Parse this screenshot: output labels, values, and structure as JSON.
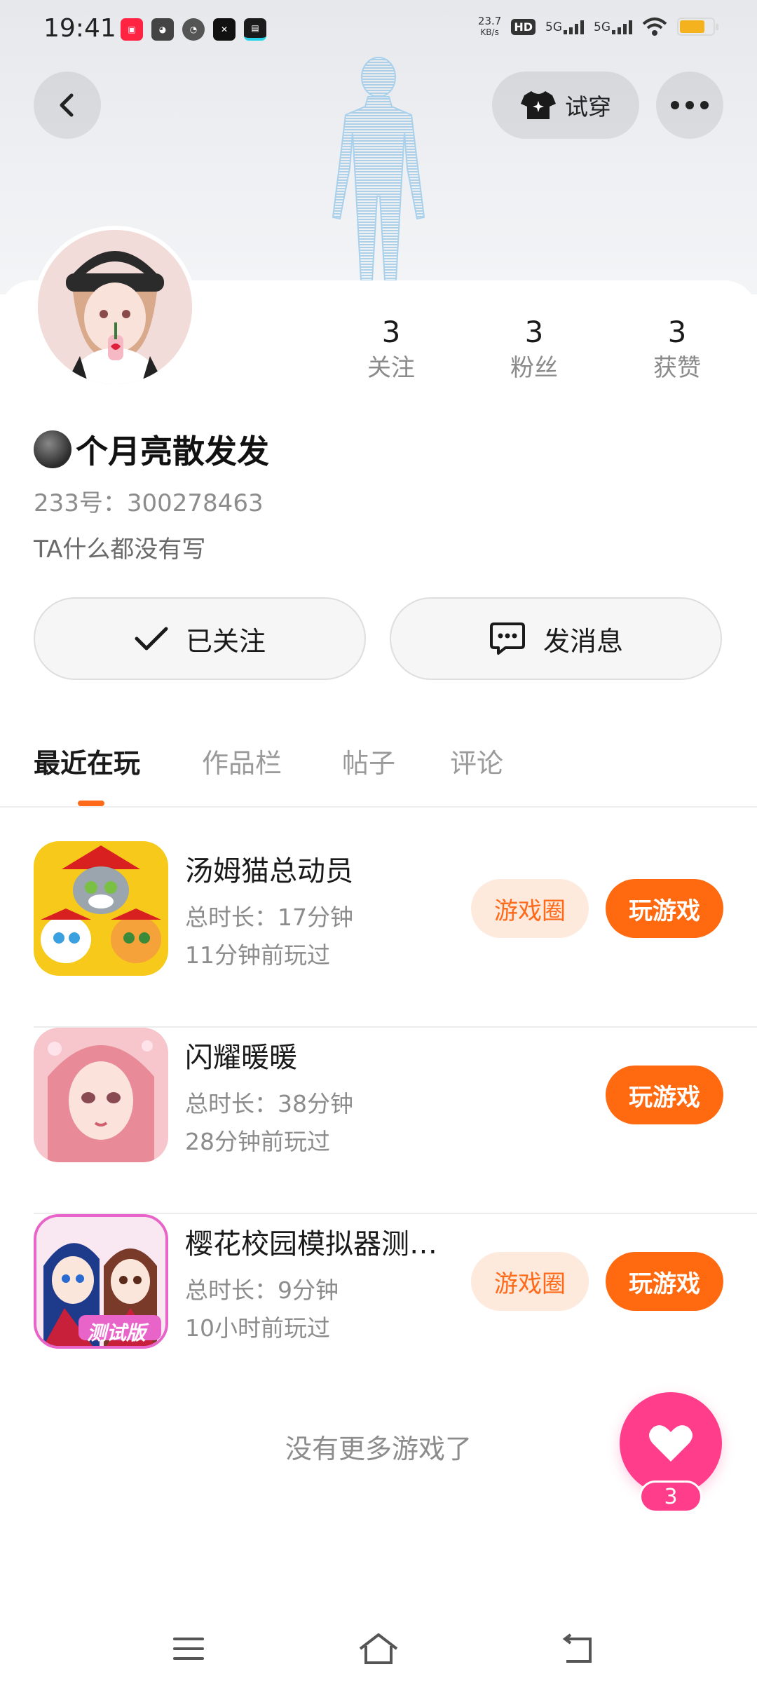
{
  "status_bar": {
    "time": "19:41",
    "net_speed_value": "23.7",
    "net_speed_unit": "KB/s",
    "hd_label": "HD",
    "sim1": "5G",
    "sim2": "5G",
    "app_icons": [
      "xiaohongshu-icon",
      "cat-icon",
      "speedometer-icon",
      "capcut-icon",
      "youku-icon"
    ],
    "battery_level": 0.76
  },
  "header": {
    "try_on_label": "试穿"
  },
  "profile": {
    "nickname": "个月亮散发发",
    "uid": "233号：300278463",
    "bio": "TA什么都没有写",
    "stats": [
      {
        "value": "3",
        "label": "关注"
      },
      {
        "value": "3",
        "label": "粉丝"
      },
      {
        "value": "3",
        "label": "获赞"
      }
    ]
  },
  "actions": {
    "followed_label": "已关注",
    "message_label": "发消息"
  },
  "tabs": [
    {
      "label": "最近在玩",
      "active": true
    },
    {
      "label": "作品栏",
      "active": false
    },
    {
      "label": "帖子",
      "active": false
    },
    {
      "label": "评论",
      "active": false
    }
  ],
  "games": [
    {
      "title": "汤姆猫总动员",
      "duration": "总时长：17分钟",
      "last_played": "11分钟前玩过",
      "circle_label": "游戏圈",
      "play_label": "玩游戏"
    },
    {
      "title": "闪耀暖暖",
      "duration": "总时长：38分钟",
      "last_played": "28分钟前玩过",
      "circle_label": "",
      "play_label": "玩游戏"
    },
    {
      "title": "樱花校园模拟器测…",
      "duration": "总时长：9分钟",
      "last_played": "10小时前玩过",
      "circle_label": "游戏圈",
      "play_label": "玩游戏",
      "icon_badge": "测试版"
    }
  ],
  "list_end_text": "没有更多游戏了",
  "like_fab": {
    "count": "3"
  },
  "colors": {
    "accent": "#ff6a10",
    "accent_light": "#fdeadc",
    "like_pink": "#ff3d8a"
  }
}
